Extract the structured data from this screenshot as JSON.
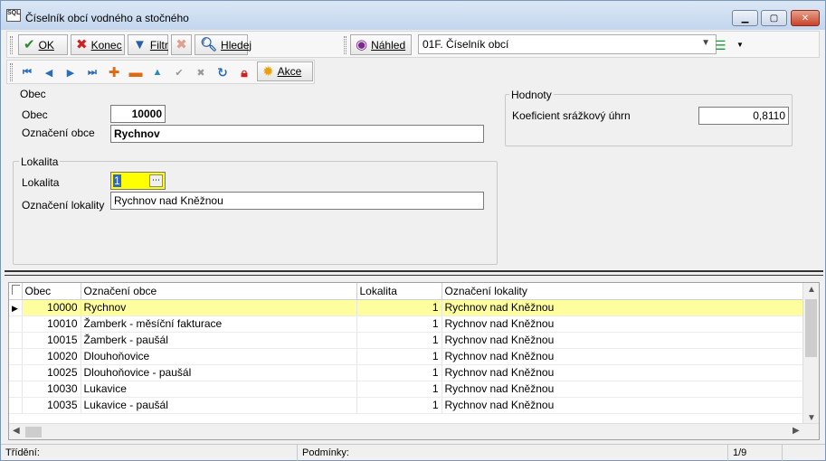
{
  "window": {
    "title": "Číselník obcí vodného a stočného",
    "app_icon": "SQL"
  },
  "toolbar": {
    "ok_label": "OK",
    "konec_label": "Konec",
    "filtr_label": "Filtr",
    "hledej_label": "Hledej",
    "nahled_label": "Náhled",
    "report_select": "01F. Číselník obcí",
    "akce_label": "Akce"
  },
  "obec_group": {
    "title": "Obec",
    "obec_label": "Obec",
    "obec_value": "10000",
    "oznaceni_label": "Označení obce",
    "oznaceni_value": "Rychnov"
  },
  "lokalita_group": {
    "title": "Lokalita",
    "lokalita_label": "Lokalita",
    "lokalita_value": "1",
    "oznaceni_label": "Označení lokality",
    "oznaceni_value": "Rychnov nad Kněžnou"
  },
  "hodnoty_group": {
    "title": "Hodnoty",
    "koef_label": "Koeficient srážkový úhrn",
    "koef_value": "0,8110"
  },
  "grid": {
    "columns": [
      "Obec",
      "Označení obce",
      "Lokalita",
      "Označení lokality"
    ],
    "rows": [
      [
        "10000",
        "Rychnov",
        "1",
        "Rychnov nad Kněžnou"
      ],
      [
        "10010",
        "Žamberk - měsíční fakturace",
        "1",
        "Rychnov nad Kněžnou"
      ],
      [
        "10015",
        "Žamberk - paušál",
        "1",
        "Rychnov nad Kněžnou"
      ],
      [
        "10020",
        "Dlouhoňovice",
        "1",
        "Rychnov nad Kněžnou"
      ],
      [
        "10025",
        "Dlouhoňovice - paušál",
        "1",
        "Rychnov nad Kněžnou"
      ],
      [
        "10030",
        "Lukavice",
        "1",
        "Rychnov nad Kněžnou"
      ],
      [
        "10035",
        "Lukavice - paušál",
        "1",
        "Rychnov nad Kněžnou"
      ]
    ]
  },
  "status": {
    "trideni": "Třídění:",
    "podminky": "Podmínky:",
    "position": "1/9"
  },
  "colors": {
    "selected_row": "#fffe9f",
    "accent": "#3b6fb6"
  }
}
